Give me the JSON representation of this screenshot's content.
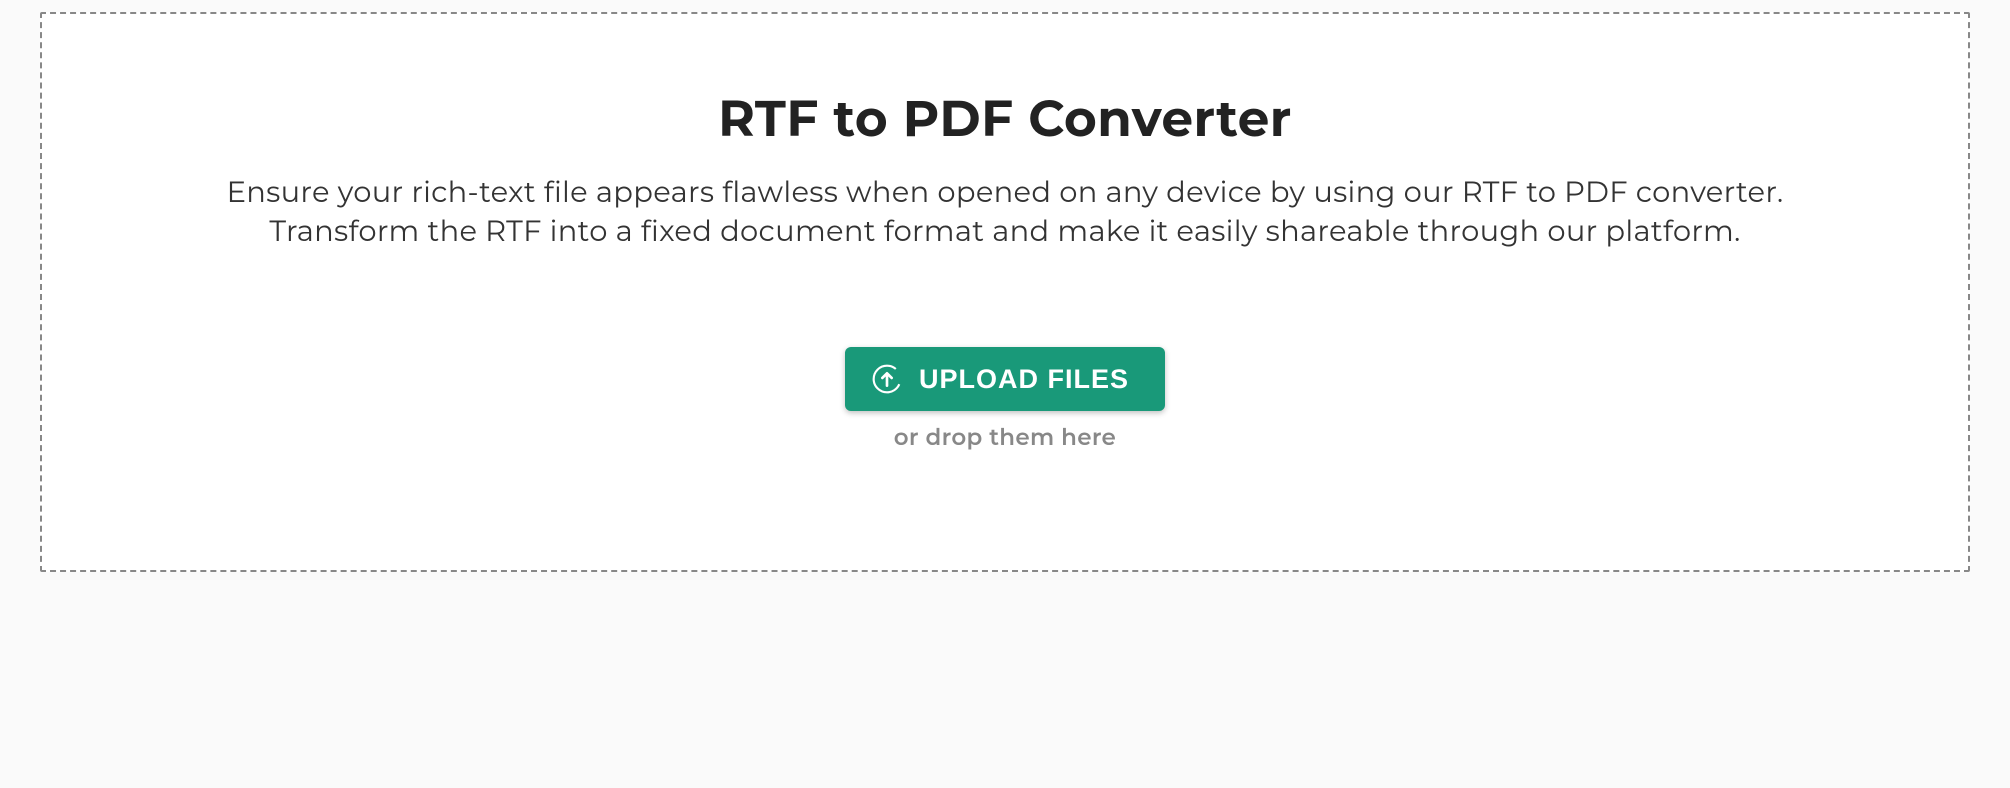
{
  "header": {
    "title": "RTF to PDF Converter",
    "description": "Ensure your rich-text file appears flawless when opened on any device by using our RTF to PDF converter. Transform the RTF into a fixed document format and make it easily shareable through our platform."
  },
  "upload": {
    "button_label": "UPLOAD FILES",
    "hint": "or drop them here"
  },
  "colors": {
    "accent": "#199979"
  }
}
